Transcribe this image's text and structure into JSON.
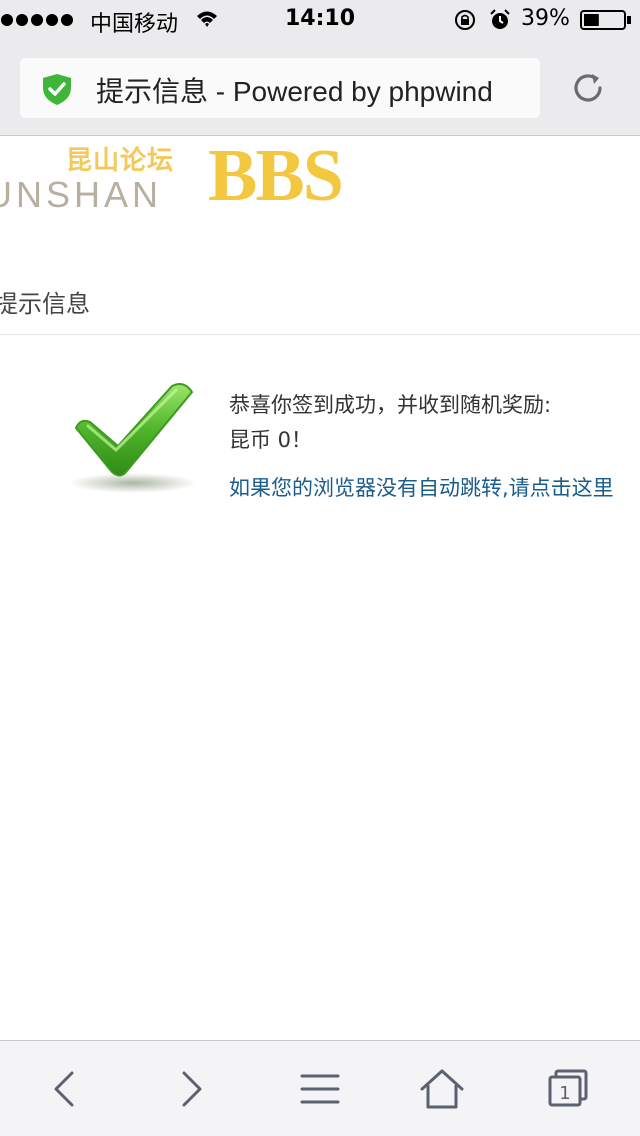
{
  "status_bar": {
    "carrier": "中国移动",
    "time": "14:10",
    "battery_percent": "39%",
    "battery_level": 0.39,
    "icons": [
      "signal-icon",
      "wifi-icon",
      "rotation-lock-icon",
      "alarm-icon",
      "battery-icon"
    ]
  },
  "address_bar": {
    "page_title": "提示信息 - Powered by phpwind",
    "icons": [
      "secure-shield-icon",
      "reload-icon"
    ]
  },
  "logo": {
    "chinese": "昆山论坛",
    "english": "UNSHAN",
    "bbs": "BBS"
  },
  "content": {
    "section_title": "提示信息",
    "message_line1": "恭喜你签到成功，并收到随机奖励:",
    "message_line2": "昆币 0！",
    "redirect_link": "如果您的浏览器没有自动跳转,请点击这里"
  },
  "toolbar": {
    "tabs_count": "1",
    "icons": [
      "back-icon",
      "forward-icon",
      "menu-icon",
      "home-icon",
      "tabs-icon"
    ]
  },
  "colors": {
    "link": "#1a5c8c",
    "logo_gold": "#f4c740",
    "check_green": "#4fb52a",
    "shield_green": "#3fb53a",
    "chrome_bg": "#ebebee"
  }
}
